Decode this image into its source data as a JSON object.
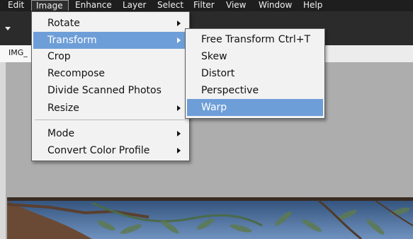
{
  "menubar": {
    "items": [
      {
        "label": "Edit"
      },
      {
        "label": "Image"
      },
      {
        "label": "Enhance"
      },
      {
        "label": "Layer"
      },
      {
        "label": "Select"
      },
      {
        "label": "Filter"
      },
      {
        "label": "View"
      },
      {
        "label": "Window"
      },
      {
        "label": "Help"
      }
    ]
  },
  "document": {
    "tab_label": "IMG_"
  },
  "image_menu": {
    "items": [
      {
        "label": "Rotate",
        "has_submenu": true
      },
      {
        "label": "Transform",
        "has_submenu": true,
        "highlighted": true
      },
      {
        "label": "Crop"
      },
      {
        "label": "Recompose"
      },
      {
        "label": "Divide Scanned Photos"
      },
      {
        "label": "Resize",
        "has_submenu": true
      },
      {
        "label": "Mode",
        "has_submenu": true
      },
      {
        "label": "Convert Color Profile",
        "has_submenu": true
      }
    ]
  },
  "transform_menu": {
    "items": [
      {
        "label": "Free Transform",
        "shortcut": "Ctrl+T"
      },
      {
        "label": "Skew"
      },
      {
        "label": "Distort"
      },
      {
        "label": "Perspective"
      },
      {
        "label": "Warp",
        "highlighted": true
      }
    ]
  },
  "colors": {
    "menu_highlight": "#6e9ed8",
    "menubar_bg": "#1e1e1e",
    "canvas_bg": "#adadad"
  }
}
